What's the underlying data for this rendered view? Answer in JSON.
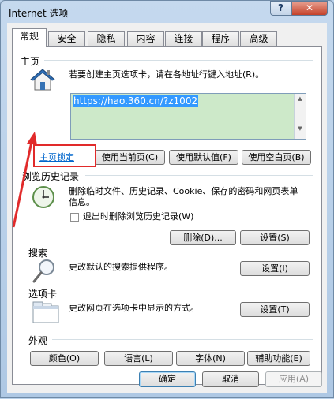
{
  "window": {
    "title": "Internet 选项",
    "help_label": "?",
    "close_label": "✕"
  },
  "tabs": [
    {
      "label": "常规",
      "active": true
    },
    {
      "label": "安全"
    },
    {
      "label": "隐私"
    },
    {
      "label": "内容"
    },
    {
      "label": "连接"
    },
    {
      "label": "程序"
    },
    {
      "label": "高级"
    }
  ],
  "homepage": {
    "section_label": "主页",
    "description": "若要创建主页选项卡，请在各地址行键入地址(R)。",
    "url": "https://hao.360.cn/?z1002",
    "lock_link": "主页锁定",
    "use_current": "使用当前页(C)",
    "use_default": "使用默认值(F)",
    "use_blank": "使用空白页(B)"
  },
  "history": {
    "section_label": "浏览历史记录",
    "description": "删除临时文件、历史记录、Cookie、保存的密码和网页表单信息。",
    "exit_checkbox": "退出时删除浏览历史记录(W)",
    "delete_button": "删除(D)...",
    "settings_button": "设置(S)"
  },
  "search": {
    "section_label": "搜索",
    "description": "更改默认的搜索提供程序。",
    "settings_button": "设置(I)"
  },
  "tabs_section": {
    "section_label": "选项卡",
    "description": "更改网页在选项卡中显示的方式。",
    "settings_button": "设置(T)"
  },
  "appearance": {
    "section_label": "外观",
    "colors": "颜色(O)",
    "languages": "语言(L)",
    "fonts": "字体(N)",
    "accessibility": "辅助功能(E)"
  },
  "footer": {
    "ok": "确定",
    "cancel": "取消",
    "apply": "应用(A)"
  },
  "colors": {
    "annotation_red": "#e12a2a",
    "link_blue": "#0066cc",
    "selection_blue": "#3399ff"
  }
}
